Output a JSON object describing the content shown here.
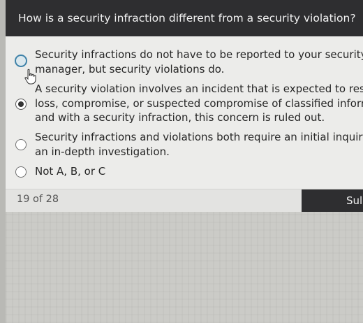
{
  "question": {
    "text": "How is a security infraction different from a security violation?"
  },
  "options": [
    {
      "lines": [
        "Security infractions do not have to be reported to your security",
        "manager, but security violations do."
      ],
      "state": "hover"
    },
    {
      "lines": [
        "A security violation involves an incident that is expected to result",
        "loss, compromise, or suspected compromise of classified inform",
        "and with a security infraction, this concern is ruled out."
      ],
      "state": "selected"
    },
    {
      "lines": [
        "Security infractions and violations both require an initial inquiry",
        "an in-depth investigation."
      ],
      "state": "unselected"
    },
    {
      "lines": [
        "Not A, B, or C"
      ],
      "state": "unselected"
    }
  ],
  "footer": {
    "progress": "19 of 28",
    "submit_label": "Sul"
  },
  "icons": {
    "cursor": "hand-pointer-icon"
  }
}
